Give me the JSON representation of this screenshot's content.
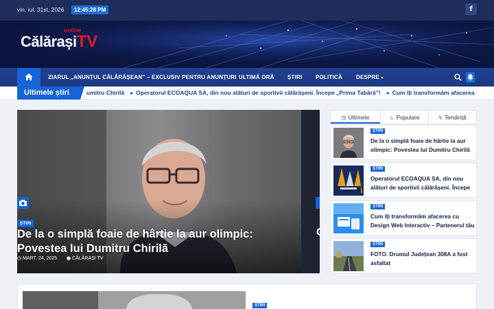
{
  "topbar": {
    "date": "vin. iul. 31st, 2026",
    "clock": "12:45:28 PM",
    "social_icon": "facebook-icon"
  },
  "brand": {
    "name": "Călărași",
    "tv": "TV",
    "online": "online"
  },
  "nav": {
    "items": [
      {
        "label": "ZIARUL „ANUNȚUL CĂLĂRĂȘEAN” – EXCLUSIV PENTRU ANUNȚURI"
      },
      {
        "label": "ULTIMĂ ORĂ"
      },
      {
        "label": "ȘTIRI"
      },
      {
        "label": "POLITICĂ"
      },
      {
        "label": "DESPRE"
      }
    ],
    "dropdown_caret": "▾"
  },
  "ticker": {
    "label": "Ultimele știri",
    "items": [
      "umitru Chirilă",
      "Operatorul ECOAQUA SA, din nou alături de sportivii călărășeni. Începe „Prima Tabără”!",
      "Cum îți transformăm afacerea"
    ]
  },
  "featured": {
    "category": "ȘTIRI",
    "title": "De la o simplă foaie de hârtie la aur olimpic: Povestea lui Dumitru Chirilă",
    "date": "MART. 24, 2025",
    "author": "CĂLĂRAȘI TV",
    "next_title_fragment": "C"
  },
  "sidebar": {
    "tabs": [
      {
        "label": "Ultimele",
        "icon": "clock-icon"
      },
      {
        "label": "Populare",
        "icon": "fire-icon"
      },
      {
        "label": "Tendință",
        "icon": "bolt-icon"
      }
    ],
    "posts": [
      {
        "category": "ȘTIRI",
        "title": "De la o simplă foaie de hârtie la aur olimpic: Povestea lui Dumitru Chirilă"
      },
      {
        "category": "ȘTIRI",
        "title": "Operatorul ECOAQUA SA, din nou alături de sportivii călărășeni. Începe „Prima Tabără”!"
      },
      {
        "category": "ȘTIRI",
        "title": "Cum îți transformăm afacerea cu Design Web Interactiv – Partenerul tău digital"
      },
      {
        "category": "ȘTIRI",
        "title": "FOTO. Drumul Județean 308A a fost asfaltat"
      }
    ]
  },
  "lower_card": {
    "category": "ȘTIRI"
  },
  "colors": {
    "primary": "#1563d6",
    "navy": "#1e2d5a",
    "brand_red": "#e21b23"
  }
}
